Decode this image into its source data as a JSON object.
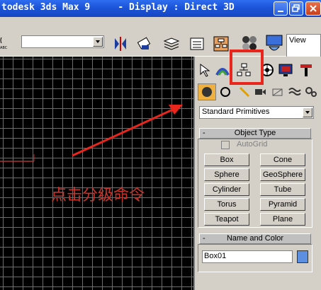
{
  "window": {
    "title": "todesk 3ds Max 9     - Display : Direct 3D",
    "colors": {
      "titlebar": "#1c54d8"
    }
  },
  "toolbar": {
    "selection_set_value": "",
    "viewport_label": "View",
    "small_label": "ABC"
  },
  "viewport": {
    "annotation_text": "点击分级命令",
    "annotation_color": "#c83228",
    "grid_color": "#6e6e6e"
  },
  "command_panel": {
    "tabs": [
      "create-tab",
      "modify-tab",
      "hierarchy-tab",
      "motion-tab",
      "display-tab",
      "utilities-tab"
    ],
    "highlighted_tab": "hierarchy-tab",
    "highlight_color": "#e8261c",
    "category_dropdown": "Standard Primitives",
    "object_type": {
      "header": "Object Type",
      "minus": "-",
      "autogrid_label": "AutoGrid",
      "buttons": [
        "Box",
        "Cone",
        "Sphere",
        "GeoSphere",
        "Cylinder",
        "Tube",
        "Torus",
        "Pyramid",
        "Teapot",
        "Plane"
      ]
    },
    "name_color": {
      "header": "Name and Color",
      "minus": "-",
      "name_value": "Box01",
      "color": "#5d8fe0"
    }
  }
}
